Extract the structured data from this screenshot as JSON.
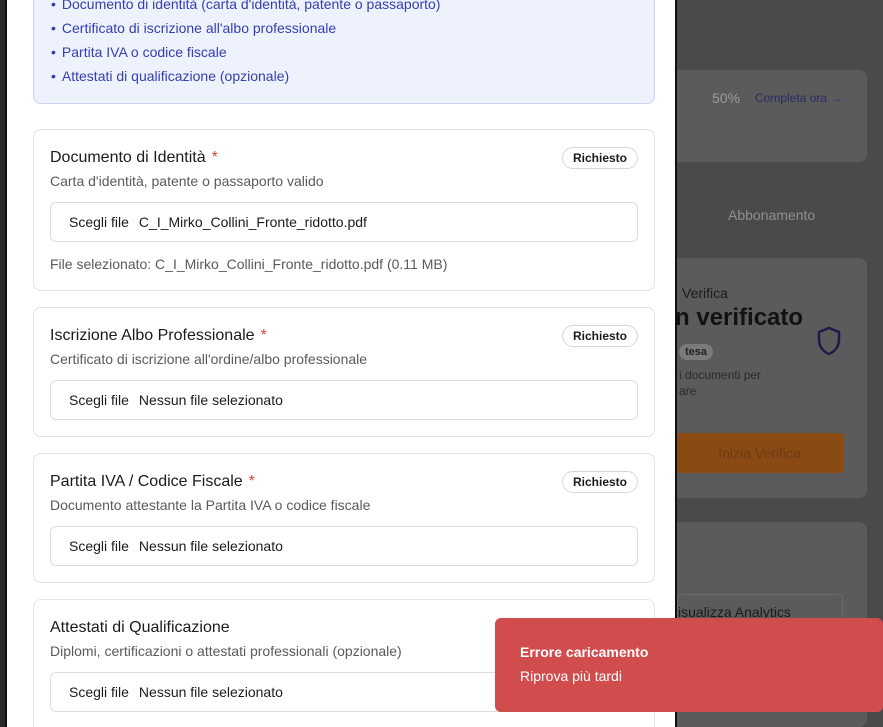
{
  "background": {
    "progress_percent": "50%",
    "progress_link": "Completa ora →",
    "tab_label": "Abbonamento",
    "verify_subtitle": "Verifica",
    "verify_status": "n verificato",
    "badge_text": "tesa",
    "docs_line1": "i documenti per",
    "docs_line2": "are",
    "start_button": "Inizia Verifica",
    "analytics_button": "isualizza Analytics"
  },
  "info": {
    "items": [
      "Documento di identità (carta d'identità, patente o passaporto)",
      "Certificato di iscrizione all'albo professionale",
      "Partita IVA o codice fiscale",
      "Attestati di qualificazione (opzionale)"
    ]
  },
  "documents": [
    {
      "title": "Documento di Identità",
      "required_mark": "*",
      "description": "Carta d'identità, patente o passaporto valido",
      "badge": "Richiesto",
      "choose_label": "Scegli file",
      "file_value": "C_I_Mirko_Collini_Fronte_ridotto.pdf",
      "selected_note": "File selezionato: C_I_Mirko_Collini_Fronte_ridotto.pdf (0.11 MB)"
    },
    {
      "title": "Iscrizione Albo Professionale",
      "required_mark": "*",
      "description": "Certificato di iscrizione all'ordine/albo professionale",
      "badge": "Richiesto",
      "choose_label": "Scegli file",
      "file_value": "Nessun file selezionato"
    },
    {
      "title": "Partita IVA / Codice Fiscale",
      "required_mark": "*",
      "description": "Documento attestante la Partita IVA o codice fiscale",
      "badge": "Richiesto",
      "choose_label": "Scegli file",
      "file_value": "Nessun file selezionato"
    },
    {
      "title": "Attestati di Qualificazione",
      "description": "Diplomi, certificazioni o attestati professionali (opzionale)",
      "choose_label": "Scegli file",
      "file_value": "Nessun file selezionato"
    }
  ],
  "toast": {
    "title": "Errore caricamento",
    "message": "Riprova più tardi"
  },
  "colors": {
    "accent_blue": "#3340b0",
    "required_red": "#d64545",
    "toast_red": "#d14c4c",
    "cta_orange": "#8a4a14"
  }
}
